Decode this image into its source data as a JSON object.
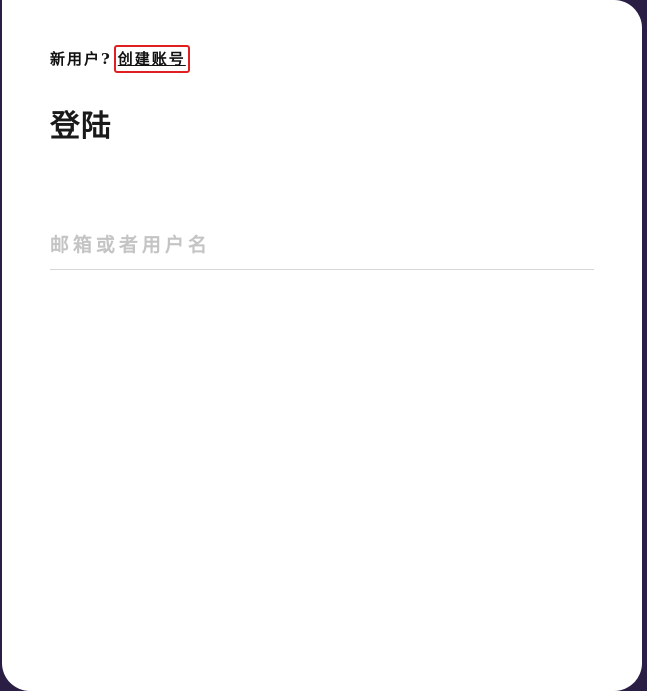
{
  "header": {
    "signup_prompt": "新用户?",
    "create_account_link": "创建账号"
  },
  "login": {
    "title": "登陆",
    "username_field": {
      "placeholder": "邮箱或者用户名",
      "value": ""
    }
  },
  "colors": {
    "page_background": "#2a1e45",
    "card_background": "#ffffff",
    "highlight_border": "#e02020",
    "placeholder_text": "#c4c4c4",
    "input_underline": "#d6d6d6"
  }
}
